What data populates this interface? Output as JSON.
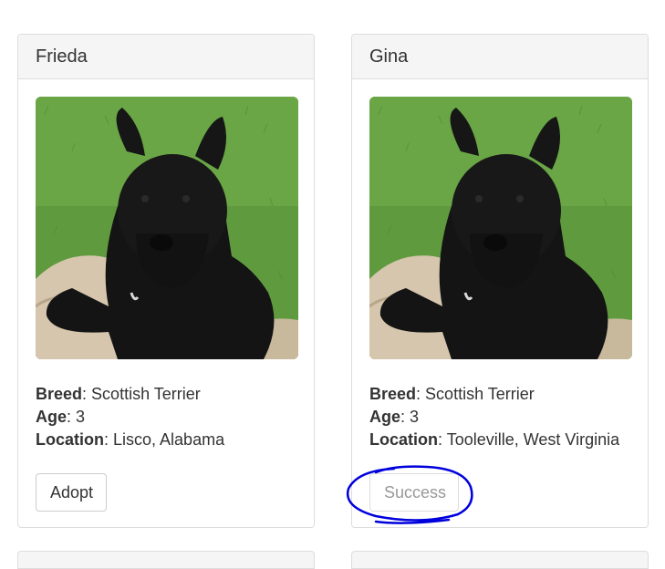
{
  "pets": [
    {
      "name": "Frieda",
      "breed_label": "Breed",
      "breed": "Scottish Terrier",
      "age_label": "Age",
      "age": "3",
      "location_label": "Location",
      "location": "Lisco, Alabama",
      "button_label": "Adopt",
      "button_state": "enabled"
    },
    {
      "name": "Gina",
      "breed_label": "Breed",
      "breed": "Scottish Terrier",
      "age_label": "Age",
      "age": "3",
      "location_label": "Location",
      "location": "Tooleville, West Virginia",
      "button_label": "Success",
      "button_state": "disabled"
    }
  ],
  "annotation": {
    "shape": "hand-drawn-circle",
    "color": "#0000dd",
    "target": "success-button"
  }
}
